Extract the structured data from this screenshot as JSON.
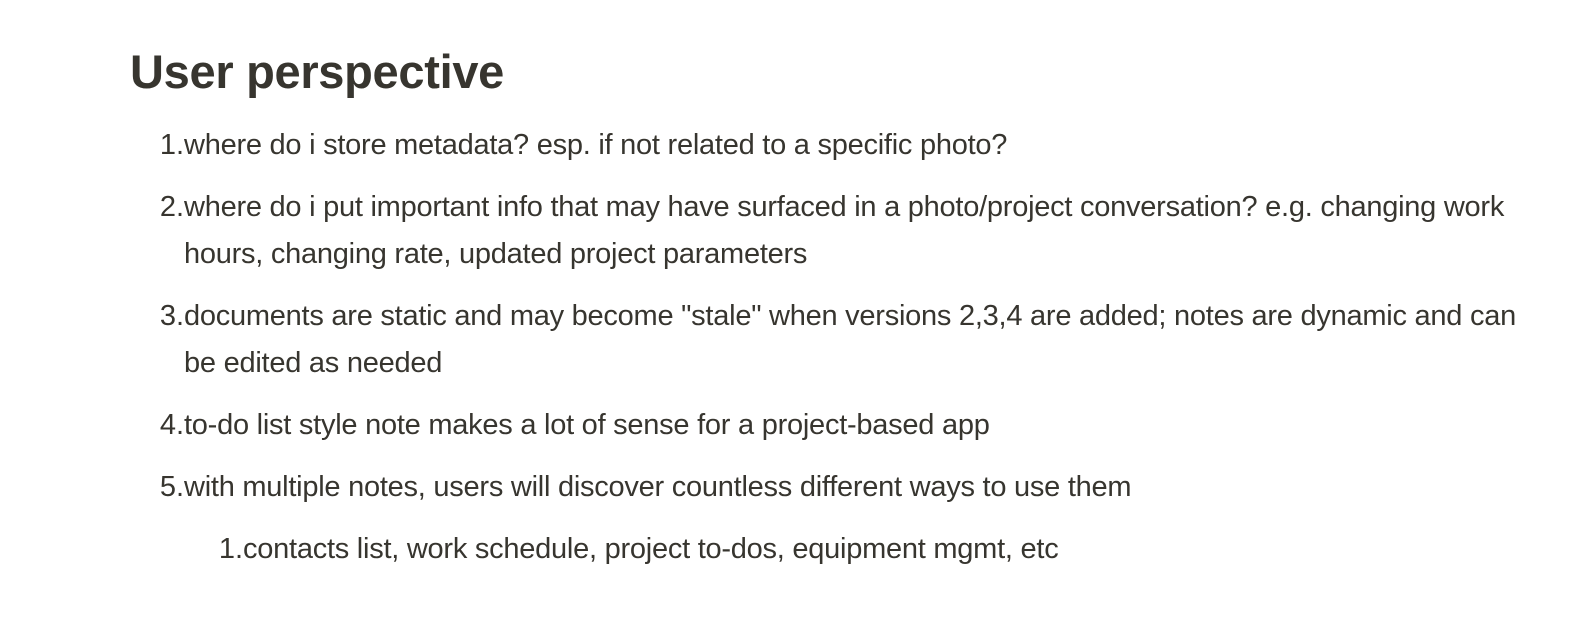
{
  "heading": "User perspective",
  "items": [
    {
      "marker": "1.",
      "text": "where do i store metadata? esp. if not related to a specific photo?"
    },
    {
      "marker": "2.",
      "text": "where do i put important info that may have surfaced in a photo/project conversation? e.g. changing work hours, changing rate, updated project parameters"
    },
    {
      "marker": "3.",
      "text": "documents are static and may become \"stale\" when versions 2,3,4 are added; notes are dynamic and can be edited as needed"
    },
    {
      "marker": "4.",
      "text": "to-do list style note makes a lot of sense for a project-based app"
    },
    {
      "marker": "5.",
      "text": "with multiple notes, users will discover countless different ways to use them"
    }
  ],
  "subitems": [
    {
      "marker": "1.",
      "text": "contacts list, work schedule, project to-dos, equipment mgmt, etc"
    }
  ]
}
